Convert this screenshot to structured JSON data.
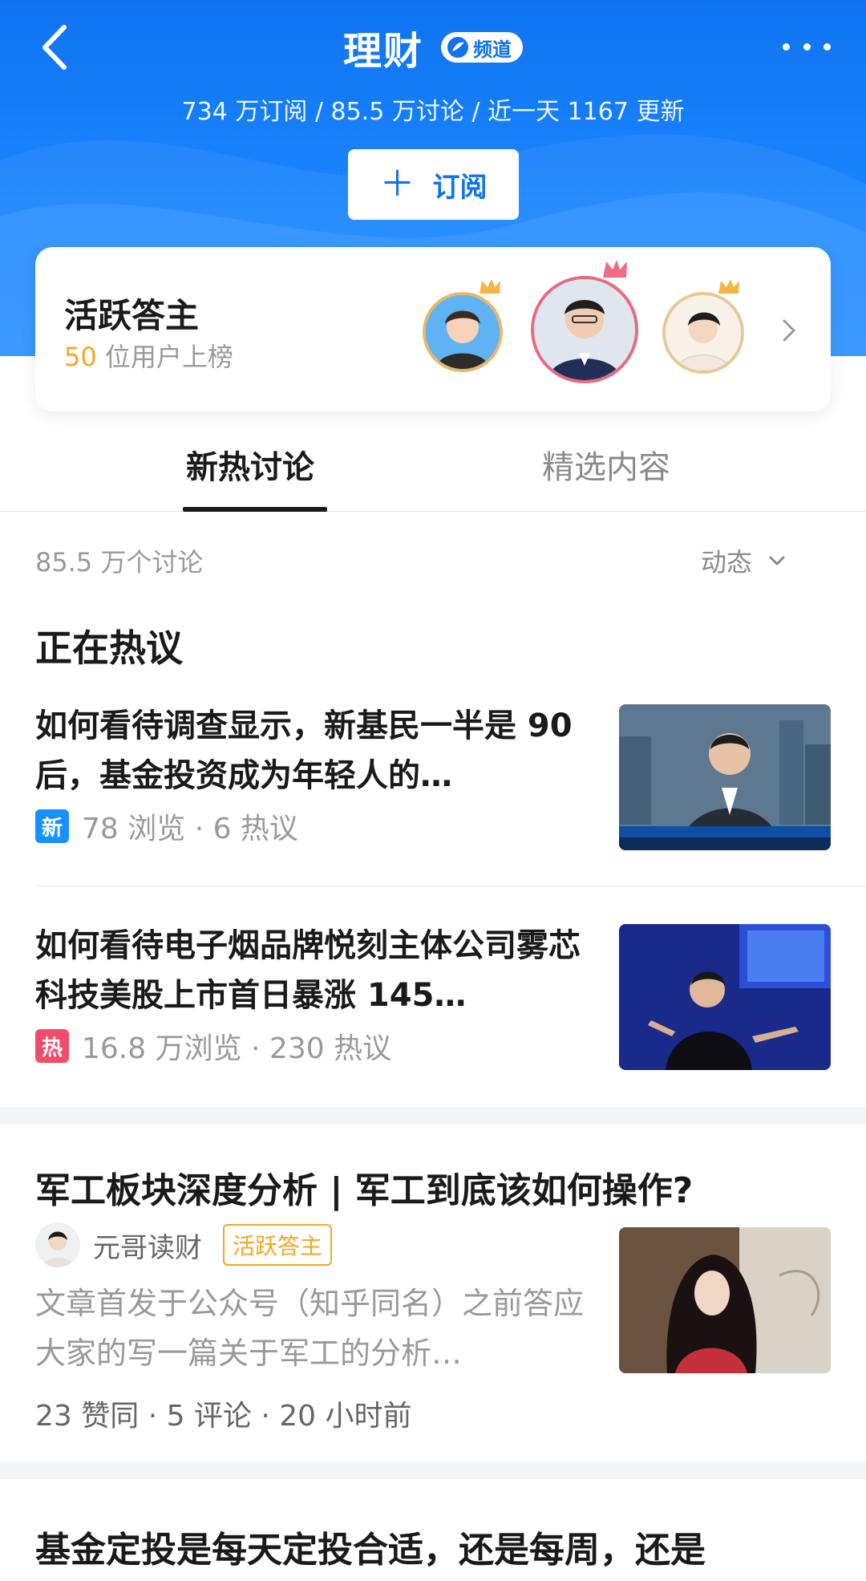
{
  "header": {
    "title": "理财",
    "channel_badge": "频道",
    "stats": "734 万订阅 / 85.5 万讨论 / 近一天 1167 更新",
    "subscribe_icon": "＋",
    "subscribe_label": "订阅"
  },
  "active_card": {
    "title": "活跃答主",
    "count": "50",
    "count_suffix": " 位用户上榜"
  },
  "tabs": [
    {
      "label": "新热讨论",
      "active": true
    },
    {
      "label": "精选内容",
      "active": false
    }
  ],
  "list_header": {
    "count": "85.5 万个讨论",
    "sort": "动态"
  },
  "section_title": "正在热议",
  "hot_items": [
    {
      "title": "如何看待调查显示，新基民一半是 90 后，基金投资成为年轻人的…",
      "tag": "新",
      "meta": "78 浏览 · 6 热议"
    },
    {
      "title": "如何看待电子烟品牌悦刻主体公司雾芯科技美股上市首日暴涨 145…",
      "tag": "热",
      "meta": "16.8 万浏览 · 230 热议"
    }
  ],
  "article": {
    "title": "军工板块深度分析 | 军工到底该如何操作?",
    "author": "元哥读财",
    "author_badge": "活跃答主",
    "excerpt": "文章首发于公众号（知乎同名）之前答应大家的写一篇关于军工的分析…",
    "meta": "23 赞同 · 5 评论 · 20 小时前"
  },
  "next_article": {
    "title": "基金定投是每天定投合适，还是每周，还是"
  },
  "colors": {
    "primary": "#0f73f0",
    "orange": "#f5a623",
    "tag_new": "#1890ff",
    "tag_hot": "#f04d6a"
  }
}
